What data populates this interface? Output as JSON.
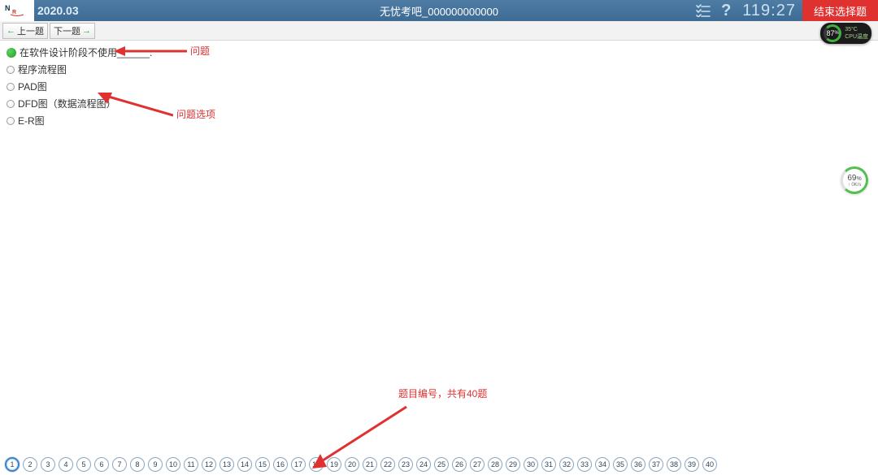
{
  "header": {
    "version": "2020.03",
    "title": "无忧考吧_000000000000",
    "timer": "119:27",
    "end_label": "结束选择题",
    "list_icon": "list-check-icon",
    "help_icon": "help-icon"
  },
  "nav": {
    "prev_label": "上一题",
    "next_label": "下一题"
  },
  "overlay": {
    "pct1": "87",
    "pct1_unit": "%",
    "temp": "35°C",
    "caption": "CPU温度",
    "pct2": "69",
    "pct2_unit": "%",
    "sub": "↑ 0K/s"
  },
  "question": {
    "stem": "在软件设计阶段不使用______.",
    "options": [
      "程序流程图",
      "PAD图",
      "DFD图（数据流程图）",
      "E-R图"
    ]
  },
  "annotations": {
    "a1": "问题",
    "a2": "问题选项",
    "a3": "题目编号，共有40题"
  },
  "qnums": {
    "total": 40,
    "current": 1
  }
}
